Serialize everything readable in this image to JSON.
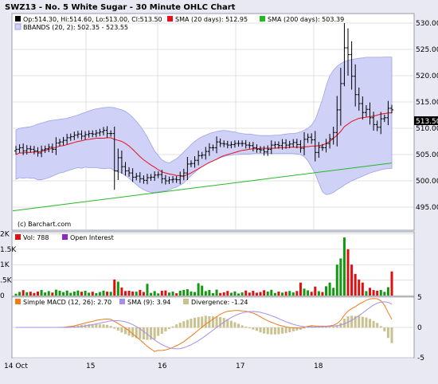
{
  "title": "SWZ13 - No. 5 White Sugar - 30 Minute OHLC Chart",
  "copyright": "(c) Barchart.com",
  "colors": {
    "bg_outer": "#e9e9f3",
    "frame": "#9a9aa8",
    "grid": "#d6d6d6",
    "sma20": "#e8101a",
    "sma200": "#22bb22",
    "bb_fill": "#cfd1f7",
    "bb_line": "#9ea3e6",
    "price": "#000000",
    "vol_up": "#119911",
    "vol_down": "#dd1111",
    "macd": "#f07a1e",
    "macd_sig": "#a78ee8",
    "hist": "#c9c190",
    "oi_swatch": "#8a2bc8",
    "last_box": "#000000"
  },
  "legend_price": {
    "ohlc": "Op:514.30, Hi:514.60, Lo:513.00, Cl:513.50",
    "sma20": "SMA (20 days): 512.95",
    "sma200": "SMA (200 days): 503.39",
    "bbands": "BBANDS (20, 2): 502.35 - 523.55"
  },
  "legend_vol": {
    "vol": "Vol: 788",
    "oi": "Open Interest"
  },
  "legend_macd": {
    "macd": "Simple MACD (12, 26): 2.70",
    "sma": "SMA (9): 3.94",
    "div": "Divergence: -1.24"
  },
  "chart_data": {
    "type": "ohlc",
    "x_labels": [
      "14 Oct",
      "15",
      "16",
      "17",
      "18"
    ],
    "last_price_label": "513.50",
    "price_axis": {
      "ylim": [
        492.5,
        532.5
      ],
      "ticks": [
        "495.00",
        "500.00",
        "505.00",
        "510.00",
        "515.00",
        "520.00",
        "525.00",
        "530.00"
      ]
    },
    "volume_axis": {
      "ylim": [
        0,
        2000
      ],
      "ticks": [
        "0",
        ".5K",
        "1K",
        "1.5K",
        "2K"
      ]
    },
    "macd_axis": {
      "ylim": [
        -5,
        5
      ],
      "ticks": [
        "-5",
        "0",
        "5"
      ]
    },
    "close": [
      506.0,
      506.3,
      505.7,
      506.1,
      506.0,
      505.7,
      505.3,
      505.9,
      506.1,
      506.4,
      506.0,
      507.2,
      507.4,
      507.7,
      508.2,
      508.4,
      508.7,
      508.9,
      508.5,
      508.8,
      509.0,
      508.9,
      509.1,
      509.3,
      509.6,
      509.0,
      509.0,
      501.9,
      504.4,
      502.7,
      501.9,
      501.5,
      500.7,
      500.9,
      500.4,
      500.1,
      500.6,
      500.7,
      501.1,
      501.2,
      500.4,
      500.0,
      500.2,
      500.3,
      500.2,
      500.9,
      501.5,
      503.2,
      503.3,
      503.9,
      504.8,
      504.9,
      505.6,
      506.3,
      506.3,
      507.4,
      507.1,
      507.0,
      506.8,
      506.9,
      507.1,
      507.1,
      507.1,
      506.8,
      506.7,
      506.3,
      506.0,
      505.9,
      505.5,
      506.0,
      506.8,
      506.9,
      506.7,
      507.2,
      506.8,
      507.0,
      507.3,
      506.9,
      506.2,
      507.9,
      508.3,
      507.8,
      505.4,
      506.4,
      506.3,
      507.1,
      508.0,
      509.2,
      513.5,
      518.5,
      525.3,
      524.0,
      519.9,
      516.4,
      514.7,
      513.0,
      513.6,
      512.0,
      510.7,
      510.2,
      511.8,
      512.0,
      513.8,
      513.5
    ],
    "sma20": [
      505.0,
      505.3,
      505.3,
      505.4,
      505.4,
      505.5,
      505.5,
      505.6,
      505.8,
      506.0,
      506.2,
      506.4,
      506.6,
      506.7,
      506.9,
      507.1,
      507.3,
      507.5,
      507.6,
      507.8,
      507.9,
      508.0,
      508.1,
      508.1,
      508.1,
      508.2,
      508.2,
      507.9,
      507.7,
      507.5,
      507.1,
      506.6,
      506.0,
      505.3,
      504.6,
      504.0,
      503.5,
      503.0,
      502.6,
      502.1,
      501.7,
      501.5,
      501.3,
      501.2,
      501.0,
      501.0,
      500.9,
      501.2,
      501.5,
      501.9,
      502.3,
      502.7,
      503.1,
      503.5,
      503.8,
      504.1,
      504.5,
      504.8,
      505.0,
      505.2,
      505.4,
      505.6,
      505.8,
      505.9,
      506.0,
      506.1,
      506.1,
      506.2,
      506.2,
      506.2,
      506.2,
      506.2,
      506.3,
      506.3,
      506.3,
      506.4,
      506.4,
      506.4,
      506.4,
      506.5,
      506.5,
      506.6,
      506.6,
      506.7,
      506.8,
      507.1,
      507.5,
      508.1,
      508.7,
      509.4,
      510.3,
      510.8,
      511.3,
      511.6,
      511.9,
      512.0,
      512.1,
      512.2,
      512.3,
      512.5,
      512.7,
      512.8,
      512.9,
      512.95
    ],
    "bb_upper": [
      509.7,
      510.0,
      510.1,
      510.2,
      510.3,
      510.5,
      510.8,
      511.0,
      511.2,
      511.4,
      511.5,
      511.6,
      511.7,
      511.8,
      511.9,
      512.1,
      512.3,
      512.5,
      512.8,
      513.0,
      513.3,
      513.5,
      513.7,
      513.8,
      513.9,
      514.0,
      514.0,
      513.9,
      513.7,
      513.5,
      513.2,
      512.7,
      512.1,
      511.3,
      510.5,
      509.5,
      508.3,
      507.0,
      505.7,
      504.8,
      504.0,
      503.6,
      503.4,
      503.8,
      504.2,
      504.8,
      505.5,
      506.2,
      506.9,
      507.5,
      508.0,
      508.4,
      508.7,
      509.0,
      509.2,
      509.4,
      509.5,
      509.6,
      509.5,
      509.4,
      509.3,
      509.1,
      509.0,
      508.9,
      508.9,
      508.8,
      508.7,
      508.6,
      508.6,
      508.6,
      508.6,
      508.7,
      508.7,
      508.8,
      508.9,
      509.0,
      509.0,
      509.1,
      509.3,
      509.6,
      510.0,
      510.6,
      511.6,
      513.5,
      515.5,
      518.0,
      520.0,
      521.0,
      521.8,
      522.3,
      522.7,
      522.9,
      523.1,
      523.2,
      523.3,
      523.4,
      523.5,
      523.5,
      523.5,
      523.5,
      523.5,
      523.55,
      523.55,
      523.55
    ],
    "bb_lower": [
      500.3,
      500.6,
      500.5,
      500.6,
      500.5,
      500.5,
      500.2,
      500.2,
      500.4,
      500.6,
      500.9,
      501.2,
      501.5,
      501.6,
      501.9,
      502.1,
      502.3,
      502.5,
      502.4,
      502.6,
      502.5,
      502.5,
      502.5,
      502.4,
      502.3,
      502.4,
      502.4,
      501.9,
      501.7,
      501.5,
      501.0,
      500.5,
      499.9,
      499.3,
      498.7,
      498.3,
      498.0,
      497.8,
      497.8,
      497.9,
      498.0,
      498.1,
      498.3,
      498.6,
      498.8,
      499.2,
      499.6,
      500.3,
      501.0,
      501.6,
      502.2,
      502.7,
      503.1,
      503.5,
      503.8,
      504.1,
      504.4,
      504.6,
      504.8,
      504.9,
      505.0,
      505.0,
      505.1,
      505.1,
      505.1,
      505.2,
      505.2,
      505.2,
      505.2,
      505.2,
      505.2,
      505.2,
      505.2,
      505.2,
      505.2,
      505.2,
      505.2,
      505.1,
      505.0,
      504.6,
      503.8,
      502.6,
      501.4,
      499.6,
      497.9,
      497.4,
      497.5,
      497.8,
      498.3,
      498.7,
      499.2,
      499.6,
      500.0,
      500.3,
      500.6,
      500.9,
      501.2,
      501.5,
      501.7,
      501.9,
      502.1,
      502.25,
      502.35,
      502.35
    ],
    "sma200_range": [
      494.3,
      503.39
    ],
    "volume_pattern_max": 1880,
    "macd": {
      "last": 2.7,
      "signal_last": 3.94,
      "divergence_last": -1.24
    }
  }
}
